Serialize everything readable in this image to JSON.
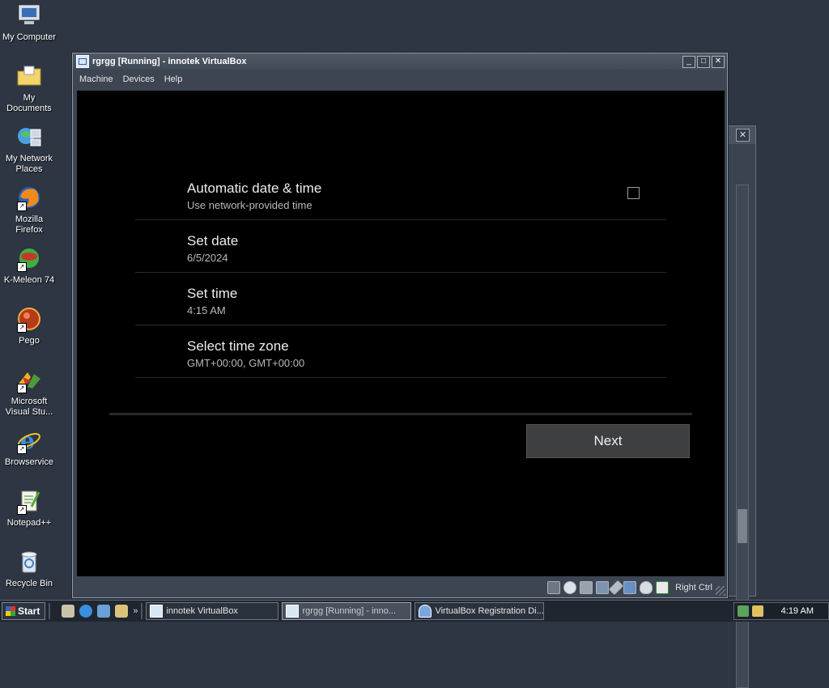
{
  "desktop": {
    "icons": [
      {
        "label": "My Computer",
        "icon": "computer-icon"
      },
      {
        "label": "My Documents",
        "icon": "folder-icon"
      },
      {
        "label": "My Network Places",
        "icon": "network-icon"
      },
      {
        "label": "Mozilla Firefox",
        "icon": "firefox-icon"
      },
      {
        "label": "K-Meleon 74",
        "icon": "kmeleon-icon"
      },
      {
        "label": "Pego",
        "icon": "pego-icon"
      },
      {
        "label": "Microsoft Visual Stu...",
        "icon": "visual-studio-icon"
      },
      {
        "label": "Browservice",
        "icon": "ie-icon"
      },
      {
        "label": "Notepad++",
        "icon": "notepad-icon"
      },
      {
        "label": "Recycle Bin",
        "icon": "recycle-bin-icon"
      }
    ]
  },
  "window": {
    "title": "rgrgg [Running] - innotek VirtualBox",
    "menu": [
      "Machine",
      "Devices",
      "Help"
    ],
    "status_host_key": "Right Ctrl"
  },
  "guest": {
    "settings": [
      {
        "title": "Automatic date & time",
        "subtitle": "Use network-provided time",
        "checkbox": false
      },
      {
        "title": "Set date",
        "subtitle": "6/5/2024"
      },
      {
        "title": "Set time",
        "subtitle": "4:15 AM"
      },
      {
        "title": "Select time zone",
        "subtitle": "GMT+00:00, GMT+00:00"
      }
    ],
    "next_label": "Next"
  },
  "taskbar": {
    "start_label": "Start",
    "tasks": [
      {
        "label": "innotek VirtualBox",
        "active": false
      },
      {
        "label": "rgrgg [Running] - inno...",
        "active": true
      },
      {
        "label": "VirtualBox Registration Di...",
        "active": false
      }
    ],
    "clock": "4:19 AM"
  },
  "colors": {
    "desktop_bg": "#2d3642",
    "guest_bg": "#000000",
    "button_bg": "#3e3f40"
  }
}
